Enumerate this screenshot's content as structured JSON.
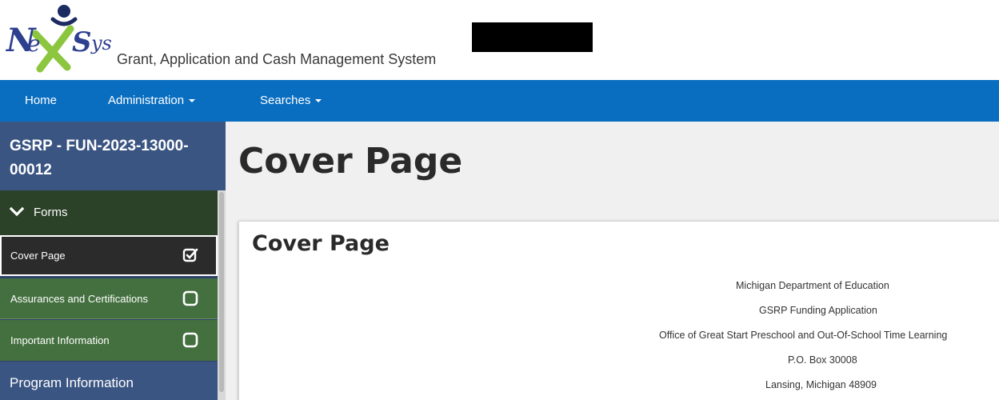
{
  "header": {
    "logo_text": "NeXSys",
    "subtitle": "Grant, Application and Cash Management System",
    "colors": {
      "logo_blue": "#2d3f8f",
      "logo_green": "#8cc63f",
      "logo_dark": "#1b2a60"
    }
  },
  "navbar": {
    "color": "#0a6ec0",
    "items": [
      {
        "label": "Home",
        "dropdown": false
      },
      {
        "label": "Administration",
        "dropdown": true
      },
      {
        "label": "Searches",
        "dropdown": true
      }
    ]
  },
  "sidebar": {
    "title": "GSRP - FUN-2023-13000-00012",
    "forms_label": "Forms",
    "items": [
      {
        "label": "Cover Page",
        "state": "checked",
        "icon": "checked-box-icon"
      },
      {
        "label": "Assurances and Certifications",
        "state": "unchecked",
        "icon": "empty-box-icon"
      },
      {
        "label": "Important Information",
        "state": "unchecked",
        "icon": "empty-box-icon"
      }
    ],
    "section_label": "Program Information"
  },
  "main": {
    "page_title": "Cover Page",
    "card_title": "Cover Page",
    "address_lines": [
      "Michigan Department of Education",
      "GSRP Funding Application",
      "Office of Great Start Preschool and Out-Of-School Time Learning",
      "P.O. Box 30008",
      "Lansing, Michigan 48909"
    ]
  }
}
